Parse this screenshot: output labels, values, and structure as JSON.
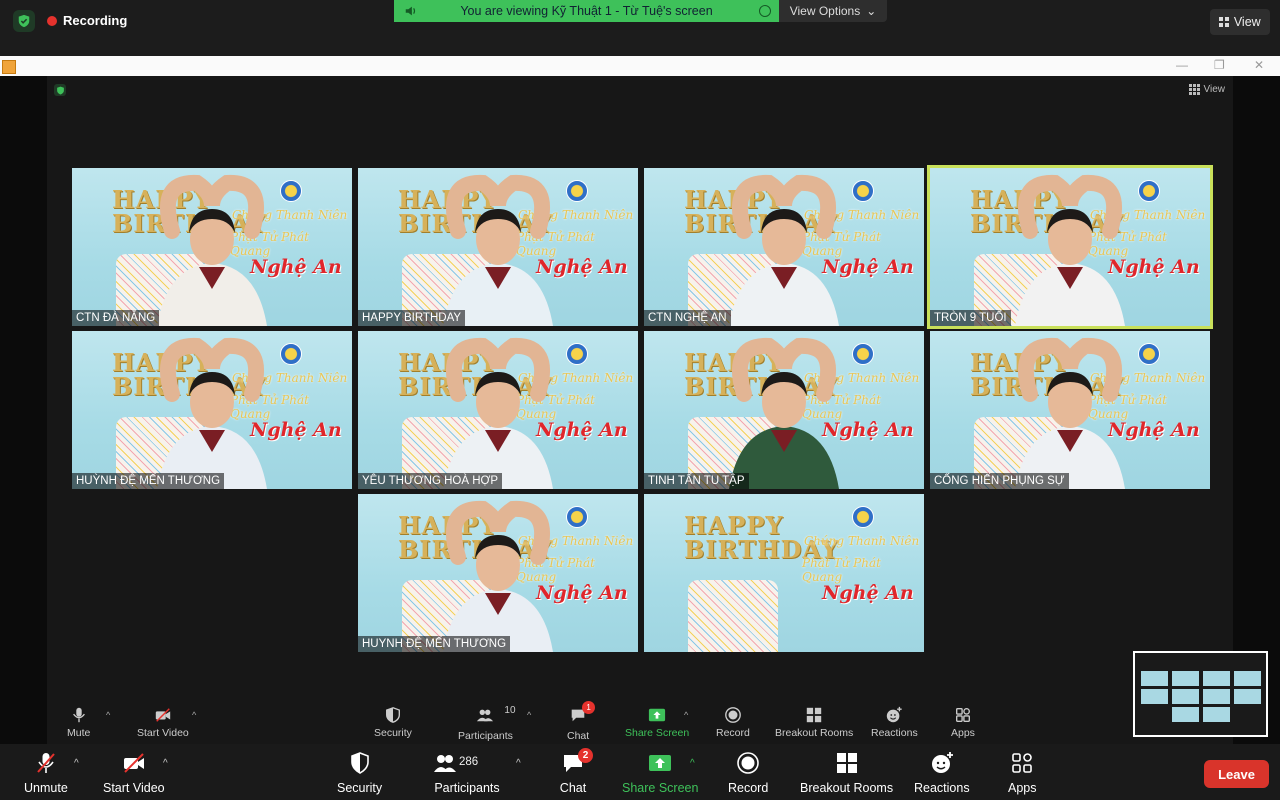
{
  "top": {
    "recording": "Recording",
    "viewing": "You are viewing Kỹ Thuật 1  - Từ Tuệ's screen",
    "view_options": "View Options",
    "view": "View"
  },
  "inner": {
    "view": "View"
  },
  "tiles": [
    {
      "label": "CTN ĐÀ NẴNG"
    },
    {
      "label": "HAPPY BIRTHDAY"
    },
    {
      "label": "CTN NGHỆ AN"
    },
    {
      "label": "TRÒN 9 TUỔI"
    },
    {
      "label": "HUỲNH ĐỆ MẾN THƯƠNG"
    },
    {
      "label": "YÊU THƯƠNG HOÀ HỢP"
    },
    {
      "label": "TINH TẤN TU TẬP"
    },
    {
      "label": "CỐNG HIẾN PHỤNG SỰ"
    },
    {
      "label": "HUYNH ĐỆ MẾN THƯƠNG"
    },
    {
      "label": ""
    }
  ],
  "backdrop": {
    "happy": "HAPPY",
    "birthday": "BIRTHDAY",
    "line1": "Chúng Thanh Niên",
    "line2": "Phật Tử Phát Quang",
    "line3": "Nghệ An"
  },
  "inner_toolbar": {
    "mute": "Mute",
    "start_video": "Start Video",
    "security": "Security",
    "participants": "Participants",
    "participants_count": "10",
    "chat": "Chat",
    "chat_badge": "1",
    "share_screen": "Share Screen",
    "record": "Record",
    "breakout": "Breakout Rooms",
    "reactions": "Reactions",
    "apps": "Apps"
  },
  "toolbar": {
    "unmute": "Unmute",
    "start_video": "Start Video",
    "security": "Security",
    "participants": "Participants",
    "participants_count": "286",
    "chat": "Chat",
    "chat_badge": "2",
    "share_screen": "Share Screen",
    "record": "Record",
    "breakout": "Breakout Rooms",
    "reactions": "Reactions",
    "apps": "Apps",
    "leave": "Leave"
  },
  "colors": {
    "accent_green": "#3ec15a",
    "leave_red": "#d9342b",
    "active_speaker": "#c9e05a"
  }
}
